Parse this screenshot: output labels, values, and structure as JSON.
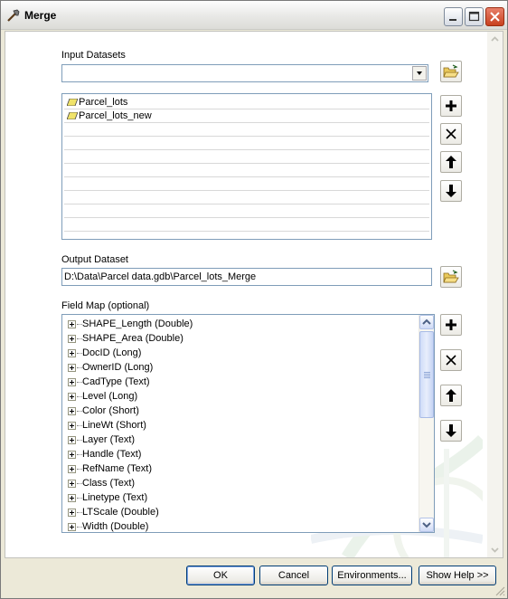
{
  "window": {
    "title": "Merge",
    "title_icon": "hammer-icon"
  },
  "input_datasets": {
    "label": "Input Datasets",
    "value": "",
    "items": [
      "Parcel_lots",
      "Parcel_lots_new"
    ]
  },
  "output_dataset": {
    "label": "Output Dataset",
    "value": "D:\\Data\\Parcel data.gdb\\Parcel_lots_Merge"
  },
  "field_map": {
    "label": "Field Map (optional)",
    "fields": [
      "SHAPE_Length (Double)",
      "SHAPE_Area (Double)",
      "DocID (Long)",
      "OwnerID (Long)",
      "CadType (Text)",
      "Level (Long)",
      "Color (Short)",
      "LineWt (Short)",
      "Layer (Text)",
      "Handle (Text)",
      "RefName (Text)",
      "Class (Text)",
      "Linetype (Text)",
      "LTScale (Double)",
      "Width (Double)"
    ]
  },
  "buttons": {
    "ok": "OK",
    "cancel": "Cancel",
    "environments": "Environments...",
    "show_help": "Show Help >>"
  },
  "colors": {
    "dialog_bg": "#ece9d8",
    "input_border": "#7f9db9",
    "close_button": "#c8401e",
    "polygon_icon": "#f0e36a"
  }
}
